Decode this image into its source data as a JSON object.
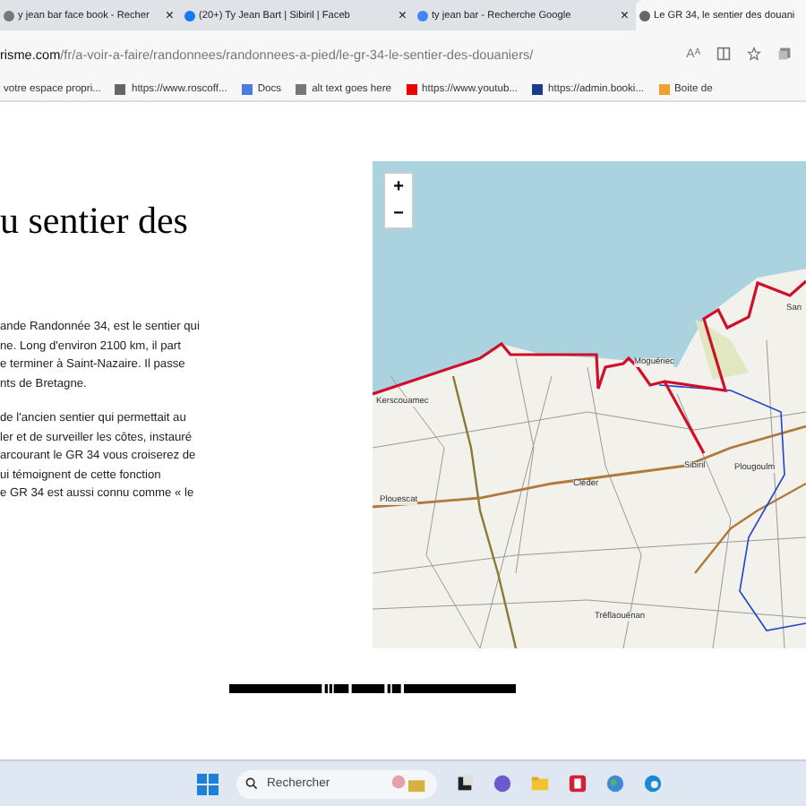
{
  "tabs": [
    {
      "title": "y jean bar face book - Recher",
      "selected": false,
      "close": "×",
      "kind": "search"
    },
    {
      "title": "(20+) Ty Jean Bart | Sibiril | Faceb",
      "selected": false,
      "close": "×",
      "kind": "facebook"
    },
    {
      "title": "ty jean bar - Recherche Google",
      "selected": false,
      "close": "×",
      "kind": "google"
    },
    {
      "title": "Le GR 34, le sentier des douani",
      "selected": true,
      "kind": "site"
    }
  ],
  "address": {
    "domain": "risme.com",
    "path": "/fr/a-voir-a-faire/randonnees/randonnees-a-pied/le-gr-34-le-sentier-des-douaniers/",
    "reader": "Aᴬ"
  },
  "bookmarks": [
    {
      "label": "votre espace propri...",
      "kind": "none"
    },
    {
      "label": "https://www.roscoff...",
      "kind": "site"
    },
    {
      "label": "Docs",
      "kind": "docs"
    },
    {
      "label": "alt text goes here",
      "kind": "page"
    },
    {
      "label": "https://www.youtub...",
      "kind": "youtube"
    },
    {
      "label": "https://admin.booki...",
      "kind": "booking"
    },
    {
      "label": "Boite de",
      "kind": "mail"
    }
  ],
  "article": {
    "heading": "u sentier des",
    "paragraphs": [
      [
        "ande Randonnée 34, est le sentier qui",
        "ne. Long d'environ 2100 km, il part",
        "e terminer à Saint-Nazaire. Il passe",
        "nts de Bretagne."
      ],
      [
        "de l'ancien sentier qui permettait au",
        "ler et de surveiller les côtes, instauré",
        "arcourant le GR 34 vous croiserez de",
        "ui témoignent de cette fonction",
        "e GR 34 est aussi connu comme « le"
      ]
    ]
  },
  "map": {
    "zoom_in": "+",
    "zoom_out": "−",
    "places": [
      "Kerscouamec",
      "Moguériec",
      "Sibiril",
      "Plougoulm",
      "Cléder",
      "Plouescat",
      "Tréflaouénan",
      "San"
    ]
  },
  "taskbar": {
    "search_placeholder": "Rechercher"
  }
}
